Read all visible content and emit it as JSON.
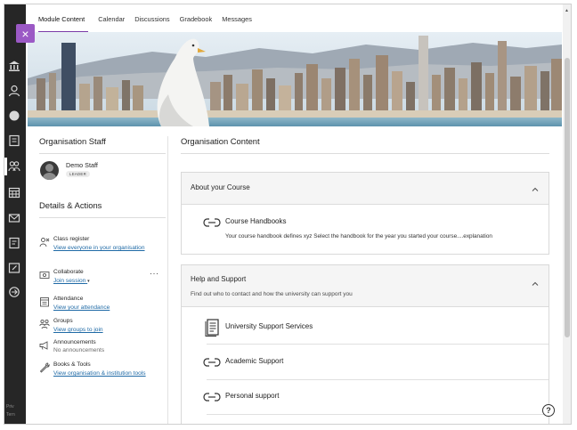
{
  "tabs": [
    {
      "label": "Module Content",
      "active": true
    },
    {
      "label": "Calendar",
      "active": false
    },
    {
      "label": "Discussions",
      "active": false
    },
    {
      "label": "Gradebook",
      "active": false
    },
    {
      "label": "Messages",
      "active": false
    }
  ],
  "close_label": "×",
  "rail": {
    "icons": [
      "institution-icon",
      "user-icon",
      "globe-icon",
      "courses-icon",
      "organisations-icon",
      "calendar-icon",
      "messages-icon",
      "grades-icon",
      "tools-icon",
      "sign-out-icon"
    ],
    "footer_1": "Priv",
    "footer_2": "Tern"
  },
  "staff": {
    "title": "Organisation Staff",
    "name": "Demo Staff",
    "role": "LEADER"
  },
  "details": {
    "title": "Details & Actions",
    "class_register": {
      "title": "Class register",
      "link": "View everyone in your organisation"
    },
    "collaborate": {
      "title": "Collaborate",
      "link": "Join session",
      "more": "···"
    },
    "attendance": {
      "title": "Attendance",
      "link": "View your attendance"
    },
    "groups": {
      "title": "Groups",
      "link": "View groups to join"
    },
    "announcements": {
      "title": "Announcements",
      "note": "No announcements"
    },
    "books": {
      "title": "Books & Tools",
      "link": "View organisation & institution tools"
    }
  },
  "content": {
    "title": "Organisation Content",
    "about": {
      "title": "About your Course",
      "item_title": "Course Handbooks",
      "item_desc": "Your course handbook defines xyz Select the handbook for the year you started your course....explanation"
    },
    "help": {
      "title": "Help and Support",
      "subtitle": "Find out who to contact and how the university can support you",
      "items": [
        "University Support Services",
        "Academic Support",
        "Personal support"
      ]
    }
  },
  "help_button": "?",
  "colors": {
    "accent": "#7b3aa8",
    "close_button": "#9b59c5",
    "link": "#1f6aa6",
    "rail": "#262626"
  }
}
